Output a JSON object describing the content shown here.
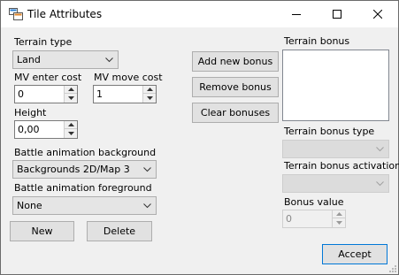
{
  "window": {
    "title": "Tile Attributes",
    "controls": [
      "minimize-icon",
      "maximize-icon",
      "close-icon"
    ]
  },
  "terrain_type": {
    "label": "Terrain type",
    "value": "Land"
  },
  "mv_enter_cost": {
    "label": "MV enter cost",
    "value": "0"
  },
  "mv_move_cost": {
    "label": "MV move cost",
    "value": "1"
  },
  "height": {
    "label": "Height",
    "value": "0,00"
  },
  "battle_bg": {
    "label": "Battle animation background",
    "value": "Backgrounds 2D/Map 3"
  },
  "battle_fg": {
    "label": "Battle animation foreground",
    "value": "None"
  },
  "buttons": {
    "add_bonus": "Add new bonus",
    "remove_bonus": "Remove bonus",
    "clear_bonuses": "Clear bonuses",
    "new": "New",
    "delete": "Delete",
    "accept": "Accept"
  },
  "terrain_bonus": {
    "label": "Terrain bonus"
  },
  "bonus_type": {
    "label": "Terrain bonus type",
    "value": ""
  },
  "bonus_activation": {
    "label": "Terrain bonus activation",
    "value": ""
  },
  "bonus_value": {
    "label": "Bonus value",
    "value": "0"
  }
}
